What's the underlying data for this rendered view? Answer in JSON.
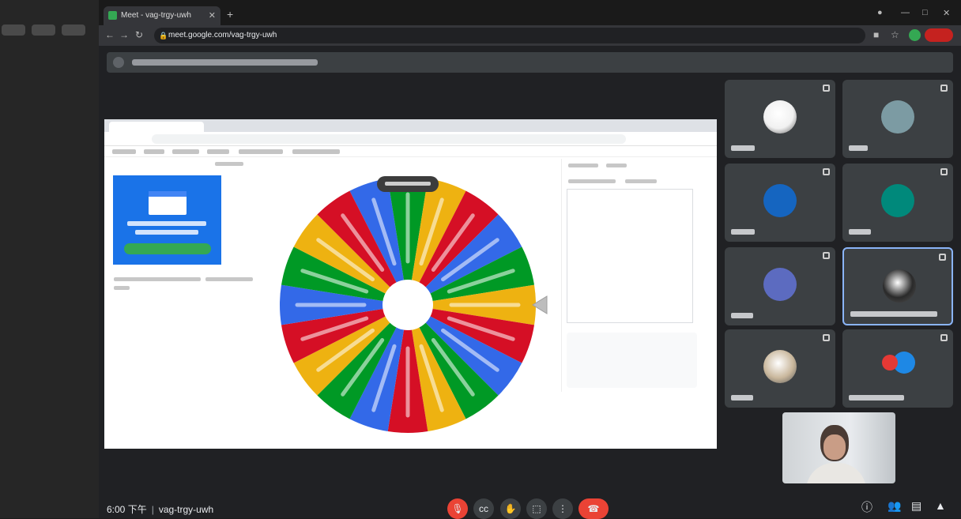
{
  "browser": {
    "tab_title": "Meet - vag-trgy-uwh",
    "url": "meet.google.com/vag-trgy-uwh"
  },
  "footer": {
    "time": "6:00 下午",
    "meeting_code": "vag-trgy-uwh"
  },
  "colors": {
    "meet_bg": "#202124",
    "tile_bg": "#3c4043",
    "end_call": "#ea4335",
    "active_border": "#8ab4f8"
  },
  "wheel": {
    "segment_colors": [
      "#009925",
      "#eeb211",
      "#d50f25",
      "#3369e8"
    ],
    "segment_count": 20
  },
  "participants": [
    {
      "avatar": "photo",
      "avatar_color": "#f1f1f1"
    },
    {
      "avatar": "initials",
      "avatar_color": "#7c9ba3"
    },
    {
      "avatar": "initials",
      "avatar_color": "#1565c0"
    },
    {
      "avatar": "initials",
      "avatar_color": "#00897b"
    },
    {
      "avatar": "initials",
      "avatar_color": "#5c6bc0"
    },
    {
      "avatar": "photo",
      "avatar_color": "#2a2a2a",
      "presenting": true
    },
    {
      "avatar": "photo",
      "avatar_color": "#c9b79c"
    },
    {
      "avatar": "group",
      "avatar_color": "#e53935"
    }
  ],
  "controls": {
    "icons": [
      "mic-off-icon",
      "captions-icon",
      "raise-hand-icon",
      "present-icon",
      "more-options-icon",
      "end-call-icon"
    ],
    "right_icons": [
      "info-icon",
      "people-icon",
      "chat-icon",
      "activities-icon"
    ]
  }
}
